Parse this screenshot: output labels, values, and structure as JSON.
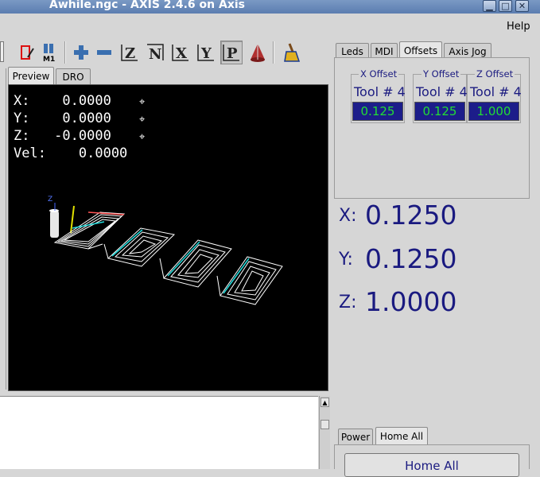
{
  "window": {
    "title": "Awhile.ngc - AXIS 2.4.6 on Axis"
  },
  "menu": {
    "help": "Help"
  },
  "left_tabs": [
    "Preview",
    "DRO"
  ],
  "dro": {
    "x_line": "X:    0.0000",
    "y_line": "Y:    0.0000",
    "z_line": "Z:   -0.0000",
    "vel_line": "Vel:    0.0000"
  },
  "right_tabs": [
    "Leds",
    "MDI",
    "Offsets",
    "Axis Jog"
  ],
  "offsets": {
    "x": {
      "caption": "X Offset",
      "tool": "Tool # 4",
      "value": "0.125"
    },
    "y": {
      "caption": "Y Offset",
      "tool": "Tool # 4",
      "value": "0.125"
    },
    "z": {
      "caption": "Z Offset",
      "tool": "Tool # 4",
      "value": "1.000"
    }
  },
  "position": {
    "x_label": "X:",
    "x_value": "0.1250",
    "y_label": "Y:",
    "y_value": "0.1250",
    "z_label": "Z:",
    "z_value": "1.0000"
  },
  "bottom_tabs": [
    "Power",
    "Home All"
  ],
  "home_all_button": "Home All",
  "preview_axis_label": "Z",
  "colors": {
    "accent": "#1a1a80",
    "offset_bg": "#1c1d8a",
    "offset_text": "#22dd33"
  }
}
